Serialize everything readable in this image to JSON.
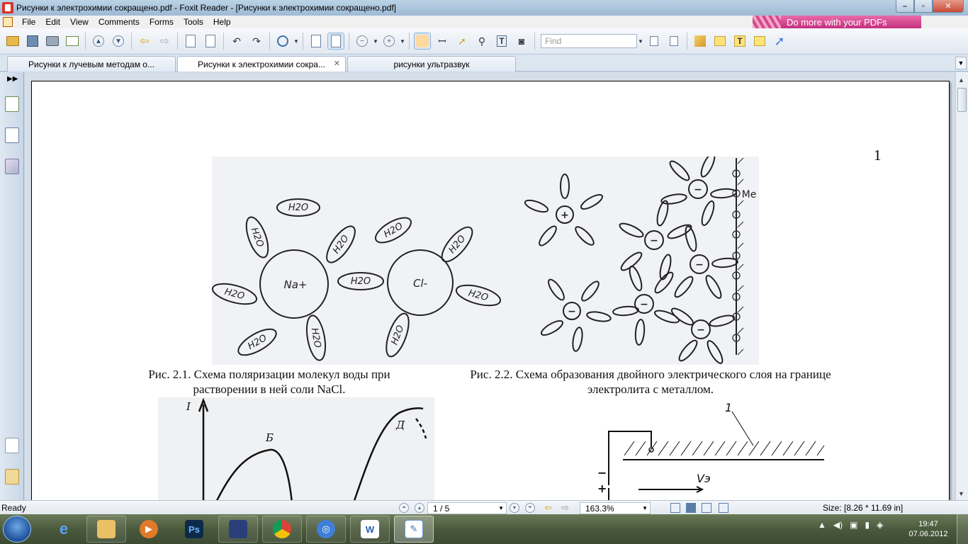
{
  "window": {
    "title": "Рисунки к электрохимии сокращено.pdf - Foxit Reader - [Рисунки к электрохимии сокращено.pdf]",
    "promo_text": "Do more with your PDFs"
  },
  "menu": [
    "File",
    "Edit",
    "View",
    "Comments",
    "Forms",
    "Tools",
    "Help"
  ],
  "toolbar": {
    "find_placeholder": "Find",
    "icons": [
      "open-icon",
      "save-icon",
      "print-icon",
      "email-icon",
      "previous-page-icon",
      "next-page-icon",
      "back-icon",
      "forward-icon",
      "extract-page-icon",
      "insert-page-icon",
      "undo-icon",
      "redo-icon",
      "zoom-in-icon",
      "fit-page-icon",
      "fit-width-icon",
      "zoom-out-icon",
      "zoom-plus-icon",
      "hand-tool-icon",
      "select-text-icon",
      "select-annotation-icon",
      "find-icon",
      "typewriter-icon",
      "snapshot-icon",
      "find-previous-icon",
      "find-next-icon",
      "pen-tool-icon",
      "highlight-icon",
      "text-box-icon",
      "note-icon",
      "arrow-tool-icon"
    ]
  },
  "tabs": [
    {
      "label": "Рисунки к лучевым методам о...",
      "active": false
    },
    {
      "label": "Рисунки к электрохимии сокра...",
      "active": true
    },
    {
      "label": "рисунки ультразвук",
      "active": false
    }
  ],
  "document": {
    "page_number": "1",
    "figure1_labels": {
      "h2o": "H2O",
      "na": "Na+",
      "cl": "Cl-",
      "me": "Me"
    },
    "caption1": "Рис. 2.1. Схема поляризации молекул воды при растворении в ней соли NaCl.",
    "caption2": "Рис. 2.2. Схема образования двойного электрического слоя на границе электролита с металлом.",
    "figure3_labels": {
      "y_axis": "I",
      "peak_b": "Б",
      "peak_d": "Д"
    },
    "figure4_labels": {
      "number": "1",
      "minus": "−",
      "plus": "+",
      "velocity": "Vэ"
    }
  },
  "status": {
    "ready": "Ready",
    "page": "1 / 5",
    "zoom": "163.3%",
    "size": "Size: [8.26 * 11.69 in]"
  },
  "taskbar": {
    "apps": [
      "internet-explorer-icon",
      "file-explorer-icon",
      "media-player-icon",
      "photoshop-icon",
      "floppy-save-icon",
      "chrome-icon",
      "network-app-icon",
      "word-icon",
      "foxit-reader-icon"
    ],
    "ps_label": "Ps",
    "word_label": "W",
    "time": "19:47",
    "date": "07.06.2012"
  }
}
